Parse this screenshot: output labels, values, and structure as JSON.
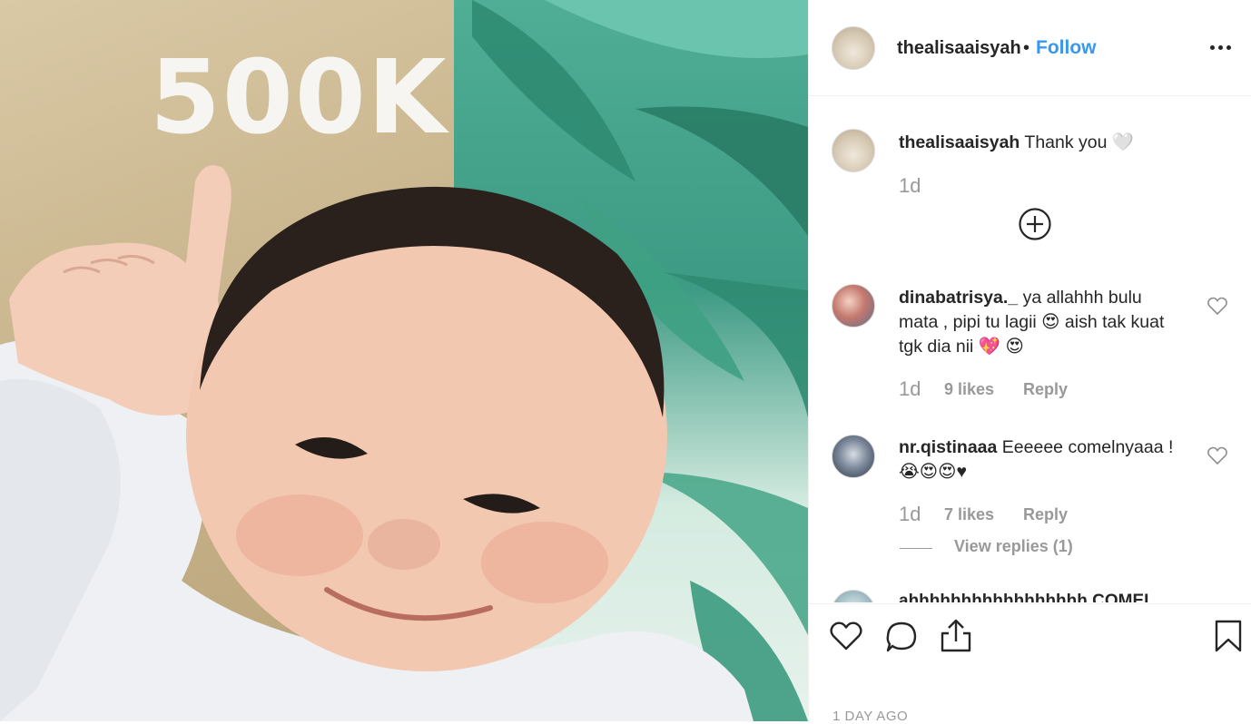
{
  "photo": {
    "overlay_text": "500K"
  },
  "header": {
    "username": "thealisaaisyah",
    "separator": "•",
    "follow_label": "Follow",
    "more_icon": "more-horizontal-icon"
  },
  "caption": {
    "username": "thealisaaisyah",
    "text": "Thank you 🤍",
    "time": "1d"
  },
  "load_more_icon": "plus-circle-icon",
  "comments": [
    {
      "username": "dinabatrisya._",
      "text": "ya allahhh bulu mata , pipi tu lagii 😍 aish tak kuat tgk dia nii 💖 😍",
      "time": "1d",
      "likes": "9 likes",
      "reply_label": "Reply"
    },
    {
      "username": "nr.qistinaaa",
      "text": "Eeeeee comelnyaaa ! 😭😍😍♥",
      "time": "1d",
      "likes": "7 likes",
      "reply_label": "Reply",
      "view_replies": "View replies (1)"
    }
  ],
  "cutoff_comment": "ahhhhhhhhhhhhhhhhh COMEL",
  "actions": {
    "like_icon": "heart-icon",
    "comment_icon": "comment-bubble-icon",
    "share_icon": "share-upload-icon",
    "save_icon": "bookmark-icon"
  },
  "timestamp": "1 DAY AGO",
  "colors": {
    "link_blue": "#3897f0",
    "text_dark": "#262626",
    "text_muted": "#999999",
    "divider": "#efefef"
  }
}
